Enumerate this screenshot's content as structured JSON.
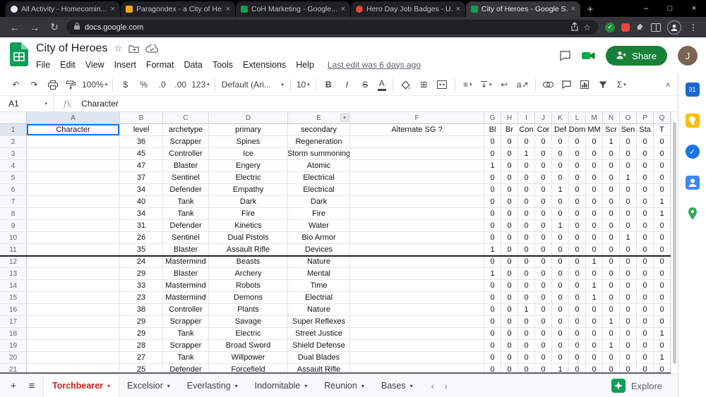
{
  "browser": {
    "tabs": [
      {
        "title": "All Activity - Homecomin...",
        "color": "#e8eaed",
        "shape": "circle",
        "active": false
      },
      {
        "title": "Paragondex - a City of He...",
        "color": "#f2a71b",
        "shape": "square",
        "active": false
      },
      {
        "title": "CoH Marketing - Google...",
        "color": "#0f9d58",
        "shape": "square",
        "active": false
      },
      {
        "title": "Hero Day Job Badges - U...",
        "color": "#e8453c",
        "shape": "circle",
        "active": false
      },
      {
        "title": "City of Heroes - Google S...",
        "color": "#0f9d58",
        "shape": "square",
        "active": true
      }
    ],
    "url": "docs.google.com"
  },
  "doc": {
    "title": "City of Heroes",
    "menus": [
      "File",
      "Edit",
      "View",
      "Insert",
      "Format",
      "Data",
      "Tools",
      "Extensions",
      "Help"
    ],
    "last_edit": "Last edit was 6 days ago",
    "share": "Share",
    "avatar": "J"
  },
  "toolbar": {
    "zoom": "100%",
    "currency": "$",
    "percent": "%",
    "decrease_decimals": ".0",
    "increase_decimals": ".00",
    "more_formats": "123",
    "font": "Default (Ari...",
    "font_size": "10",
    "bold": "B",
    "italic": "I",
    "strikethrough": "S",
    "text_color": "A"
  },
  "formula_bar": {
    "cell_ref": "A1",
    "fx": "fx",
    "value": "Character"
  },
  "grid": {
    "column_letters": [
      "A",
      "B",
      "C",
      "D",
      "E",
      "F",
      "G",
      "H",
      "I",
      "J",
      "K",
      "L",
      "M",
      "N",
      "O",
      "P",
      "Q"
    ],
    "row1": [
      "Character",
      "level",
      "archetype",
      "primary",
      "secondary",
      "Alternate SG ?",
      "Bl",
      "Br",
      "Con",
      "Cor",
      "Def",
      "Dom",
      "MM",
      "Scr",
      "Sen",
      "Sta",
      "T"
    ],
    "rows": [
      {
        "n": 2,
        "level": "36",
        "archetype": "Scrapper",
        "primary": "Spines",
        "secondary": "Regeneration",
        "alternate_sg": "",
        "flags": [
          0,
          0,
          0,
          0,
          0,
          0,
          0,
          1,
          0,
          0,
          0
        ]
      },
      {
        "n": 3,
        "level": "45",
        "archetype": "Controller",
        "primary": "Ice",
        "secondary": "Storm summoning",
        "alternate_sg": "",
        "flags": [
          0,
          0,
          1,
          0,
          0,
          0,
          0,
          0,
          0,
          0,
          0
        ]
      },
      {
        "n": 4,
        "level": "47",
        "archetype": "Blaster",
        "primary": "Engery",
        "secondary": "Atomic",
        "alternate_sg": "",
        "flags": [
          1,
          0,
          0,
          0,
          0,
          0,
          0,
          0,
          0,
          0,
          0
        ]
      },
      {
        "n": 5,
        "level": "37",
        "archetype": "Sentinel",
        "primary": "Electric",
        "secondary": "Electrical",
        "alternate_sg": "",
        "flags": [
          0,
          0,
          0,
          0,
          0,
          0,
          0,
          0,
          1,
          0,
          0
        ]
      },
      {
        "n": 6,
        "level": "34",
        "archetype": "Defender",
        "primary": "Empathy",
        "secondary": "Electrical",
        "alternate_sg": "",
        "flags": [
          0,
          0,
          0,
          0,
          1,
          0,
          0,
          0,
          0,
          0,
          0
        ]
      },
      {
        "n": 7,
        "level": "40",
        "archetype": "Tank",
        "primary": "Dark",
        "secondary": "Dark",
        "alternate_sg": "",
        "flags": [
          0,
          0,
          0,
          0,
          0,
          0,
          0,
          0,
          0,
          0,
          1
        ]
      },
      {
        "n": 8,
        "level": "34",
        "archetype": "Tank",
        "primary": "Fire",
        "secondary": "Fire",
        "alternate_sg": "",
        "flags": [
          0,
          0,
          0,
          0,
          0,
          0,
          0,
          0,
          0,
          0,
          1
        ]
      },
      {
        "n": 9,
        "level": "31",
        "archetype": "Defender",
        "primary": "Kinetics",
        "secondary": "Water",
        "alternate_sg": "",
        "flags": [
          0,
          0,
          0,
          0,
          1,
          0,
          0,
          0,
          0,
          0,
          0
        ]
      },
      {
        "n": 10,
        "level": "26",
        "archetype": "Sentinel",
        "primary": "Dual Pistols",
        "secondary": "Bio Armor",
        "alternate_sg": "",
        "flags": [
          0,
          0,
          0,
          0,
          0,
          0,
          0,
          0,
          1,
          0,
          0
        ]
      },
      {
        "n": 11,
        "level": "35",
        "archetype": "Blaster",
        "primary": "Assault Rifle",
        "secondary": "Devices",
        "alternate_sg": "",
        "flags": [
          1,
          0,
          0,
          0,
          0,
          0,
          0,
          0,
          0,
          0,
          0
        ]
      },
      {
        "n": 12,
        "level": "24",
        "archetype": "Mastermind",
        "primary": "Beasts",
        "secondary": "Nature",
        "alternate_sg": "",
        "flags": [
          0,
          0,
          0,
          0,
          0,
          0,
          1,
          0,
          0,
          0,
          0
        ]
      },
      {
        "n": 13,
        "level": "29",
        "archetype": "Blaster",
        "primary": "Archery",
        "secondary": "Mental",
        "alternate_sg": "",
        "flags": [
          1,
          0,
          0,
          0,
          0,
          0,
          0,
          0,
          0,
          0,
          0
        ]
      },
      {
        "n": 14,
        "level": "33",
        "archetype": "Mastermind",
        "primary": "Robots",
        "secondary": "Time",
        "alternate_sg": "",
        "flags": [
          0,
          0,
          0,
          0,
          0,
          0,
          1,
          0,
          0,
          0,
          0
        ]
      },
      {
        "n": 15,
        "level": "23",
        "archetype": "Mastermind",
        "primary": "Demons",
        "secondary": "Electrial",
        "alternate_sg": "",
        "flags": [
          0,
          0,
          0,
          0,
          0,
          0,
          1,
          0,
          0,
          0,
          0
        ]
      },
      {
        "n": 16,
        "level": "38",
        "archetype": "Controller",
        "primary": "Plants",
        "secondary": "Nature",
        "alternate_sg": "",
        "flags": [
          0,
          0,
          1,
          0,
          0,
          0,
          0,
          0,
          0,
          0,
          0
        ]
      },
      {
        "n": 17,
        "level": "29",
        "archetype": "Scrapper",
        "primary": "Savage",
        "secondary": "Super Reflexes",
        "alternate_sg": "",
        "flags": [
          0,
          0,
          0,
          0,
          0,
          0,
          0,
          1,
          0,
          0,
          0
        ]
      },
      {
        "n": 18,
        "level": "29",
        "archetype": "Tank",
        "primary": "Electric",
        "secondary": "Street Justice",
        "alternate_sg": "",
        "flags": [
          0,
          0,
          0,
          0,
          0,
          0,
          0,
          0,
          0,
          0,
          1
        ]
      },
      {
        "n": 19,
        "level": "28",
        "archetype": "Scrapper",
        "primary": "Broad Sword",
        "secondary": "Shield Defense",
        "alternate_sg": "",
        "flags": [
          0,
          0,
          0,
          0,
          0,
          0,
          0,
          1,
          0,
          0,
          0
        ]
      },
      {
        "n": 20,
        "level": "27",
        "archetype": "Tank",
        "primary": "Willpower",
        "secondary": "Dual Blades",
        "alternate_sg": "",
        "flags": [
          0,
          0,
          0,
          0,
          0,
          0,
          0,
          0,
          0,
          0,
          1
        ]
      },
      {
        "n": 21,
        "level": "25",
        "archetype": "Defender",
        "primary": "Forcefield",
        "secondary": "Assault Rifle",
        "alternate_sg": "",
        "flags": [
          0,
          0,
          0,
          0,
          1,
          0,
          0,
          0,
          0,
          0,
          0
        ]
      }
    ]
  },
  "sheet_tabs": [
    {
      "label": "Torchbearer",
      "active": true
    },
    {
      "label": "Excelsior",
      "active": false
    },
    {
      "label": "Everlasting",
      "active": false
    },
    {
      "label": "Indomitable",
      "active": false
    },
    {
      "label": "Reunion",
      "active": false
    },
    {
      "label": "Bases",
      "active": false
    }
  ],
  "explore": "Explore",
  "colors": {
    "selection_blue": "#1a73e8",
    "share_green": "#188038",
    "sheets_green": "#0f9d58",
    "active_sheet_tab": "#c5221f"
  },
  "icons": {
    "plus": "+",
    "close": "×",
    "minimize": "–",
    "maximize": "□",
    "back": "←",
    "forward": "→",
    "refresh": "↻",
    "dots": "⋮",
    "star": "☆",
    "check": "✓",
    "dropdown": "▾",
    "undo": "↶",
    "redo": "↷",
    "borders": "⊞",
    "align": "≡",
    "wrap": "↩",
    "rotate": "a↗",
    "sigma": "Σ",
    "collapse": "∧",
    "chevron_left": "‹",
    "chevron_right": "›",
    "menu": "≡",
    "calendar_day": "31"
  }
}
